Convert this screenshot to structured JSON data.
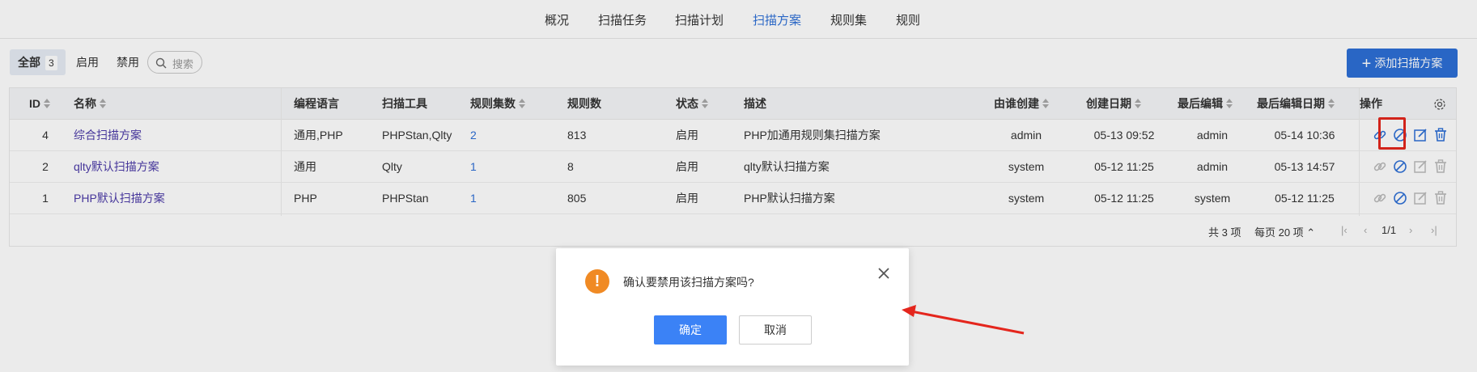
{
  "nav": {
    "items": [
      "概况",
      "扫描任务",
      "扫描计划",
      "扫描方案",
      "规则集",
      "规则"
    ],
    "active": "扫描方案"
  },
  "toolbar": {
    "filter_all": "全部",
    "filter_all_count": "3",
    "filter_enabled": "启用",
    "filter_disabled": "禁用",
    "search_placeholder": "搜索",
    "add_button": "添加扫描方案"
  },
  "table": {
    "headers": {
      "id": "ID",
      "name": "名称",
      "language": "编程语言",
      "tool": "扫描工具",
      "ruleset_count": "规则集数",
      "rule_count": "规则数",
      "status": "状态",
      "description": "描述",
      "creator": "由谁创建",
      "created": "创建日期",
      "editor": "最后编辑",
      "edited": "最后编辑日期",
      "actions": "操作"
    },
    "rows": [
      {
        "id": "4",
        "name": "综合扫描方案",
        "language": "通用,PHP",
        "tool": "PHPStan,Qlty",
        "ruleset_count": "2",
        "rule_count": "813",
        "status": "启用",
        "description": "PHP加通用规则集扫描方案",
        "creator": "admin",
        "created": "05-13 09:52",
        "editor": "admin",
        "edited": "05-14 10:36"
      },
      {
        "id": "2",
        "name": "qlty默认扫描方案",
        "language": "通用",
        "tool": "Qlty",
        "ruleset_count": "1",
        "rule_count": "8",
        "status": "启用",
        "description": "qlty默认扫描方案",
        "creator": "system",
        "created": "05-12 11:25",
        "editor": "admin",
        "edited": "05-13 14:57"
      },
      {
        "id": "1",
        "name": "PHP默认扫描方案",
        "language": "PHP",
        "tool": "PHPStan",
        "ruleset_count": "1",
        "rule_count": "805",
        "status": "启用",
        "description": "PHP默认扫描方案",
        "creator": "system",
        "created": "05-12 11:25",
        "editor": "system",
        "edited": "05-12 11:25"
      }
    ]
  },
  "pager": {
    "total": "共 3 项",
    "per_page": "每页 20 项",
    "page": "1/1"
  },
  "dialog": {
    "message": "确认要禁用该扫描方案吗?",
    "ok": "确定",
    "cancel": "取消"
  },
  "colors": {
    "primary": "#2d6fd6",
    "warning": "#f08a24",
    "annotation": "#e4261d"
  },
  "icons": [
    "search-icon",
    "plus-icon",
    "sort-icon",
    "settings-icon",
    "link-icon",
    "disable-icon",
    "edit-icon",
    "delete-icon",
    "warning-icon",
    "close-icon",
    "arrow-annotation"
  ]
}
